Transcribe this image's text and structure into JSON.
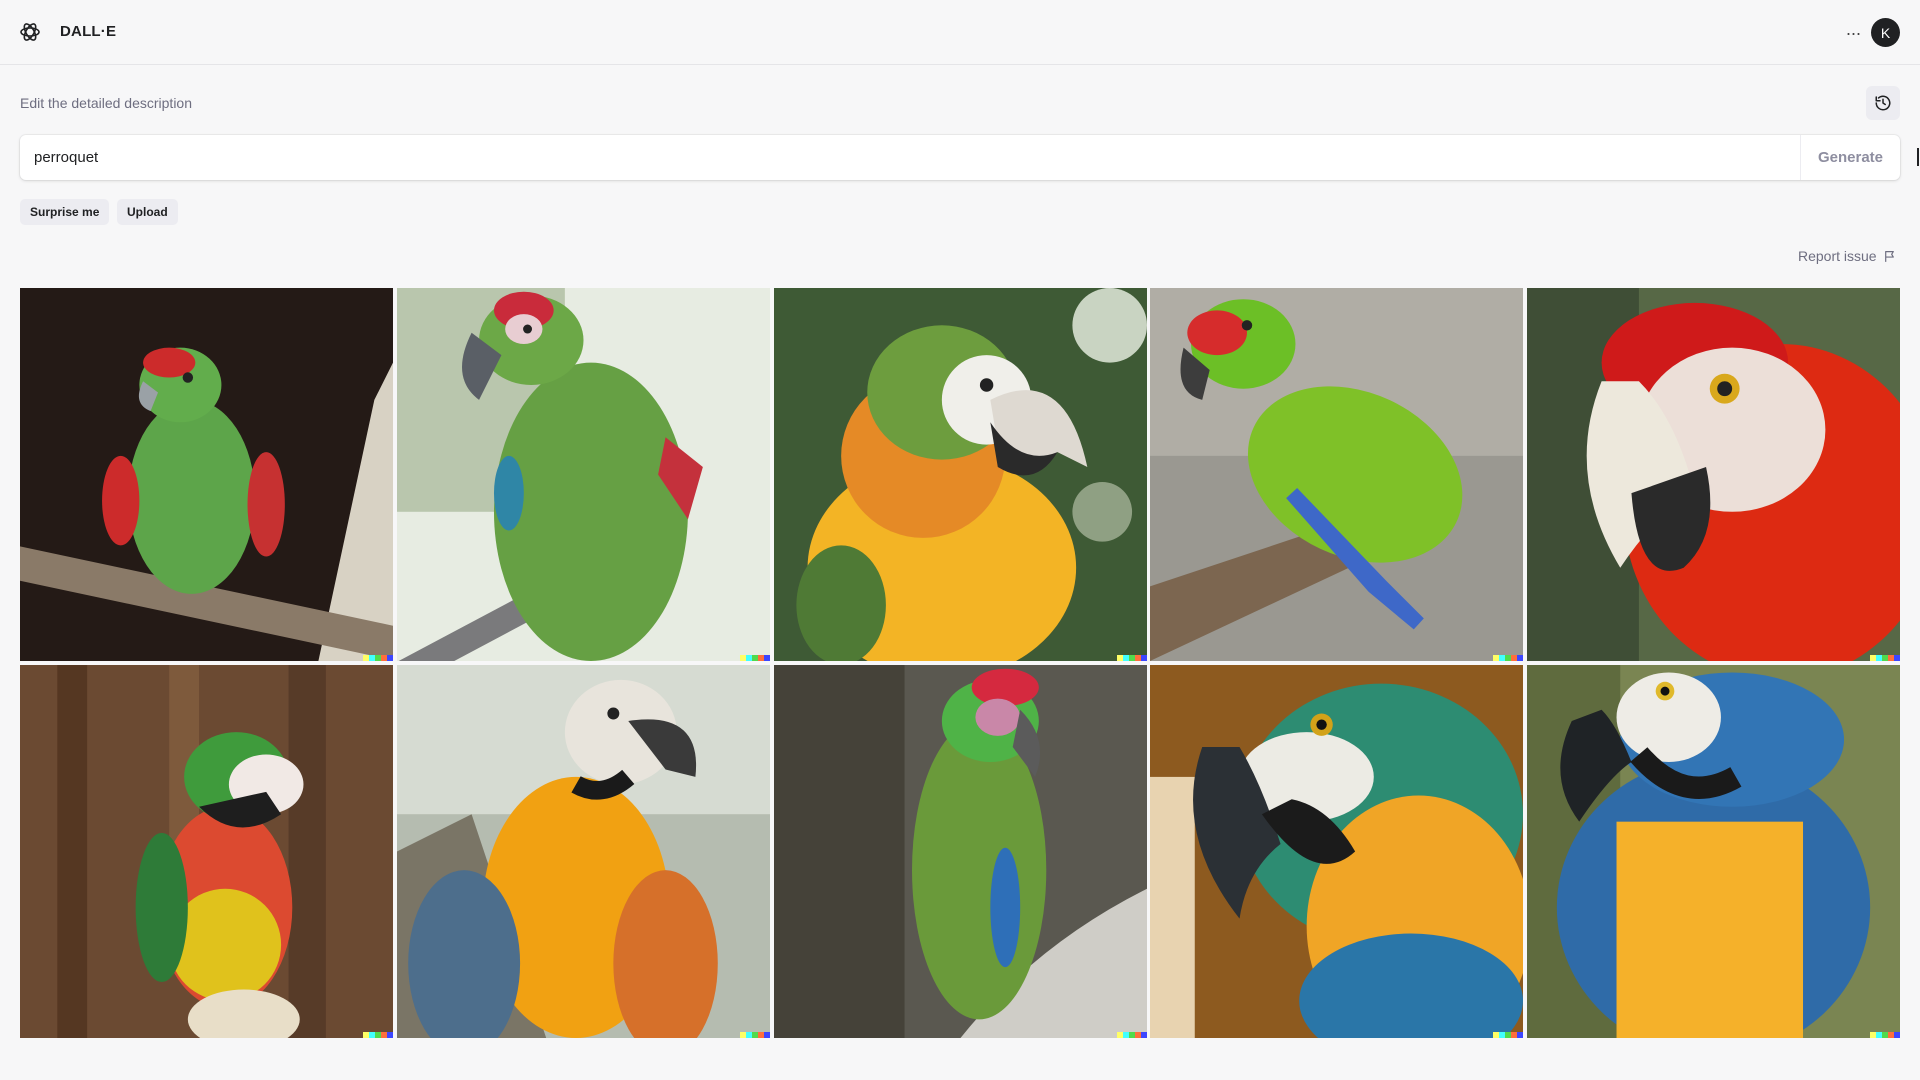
{
  "header": {
    "title": "DALL·E",
    "avatar_initial": "K",
    "more_label": "···"
  },
  "prompt": {
    "caption": "Edit the detailed description",
    "value": "perroquet",
    "generate_label": "Generate"
  },
  "actions": {
    "surprise_label": "Surprise me",
    "upload_label": "Upload",
    "report_label": "Report issue"
  },
  "images": [
    {
      "subject": "green parrot with red forehead on branch, dark background"
    },
    {
      "subject": "green military macaw, light background"
    },
    {
      "subject": "blue-and-gold macaw hybrid close-up, green background"
    },
    {
      "subject": "green parrot with red face on branch"
    },
    {
      "subject": "scarlet macaw head close-up"
    },
    {
      "subject": "multicolor macaw hybrid on perch"
    },
    {
      "subject": "orange macaw hybrid, blue wings"
    },
    {
      "subject": "green macaw with red forehead on rock"
    },
    {
      "subject": "blue-and-yellow macaw head close-up, brown background"
    },
    {
      "subject": "blue-and-yellow macaw portrait, green background"
    }
  ],
  "colors": {
    "accent": "#202123",
    "background": "#f7f7f8",
    "signature": [
      "#ffff66",
      "#42ffff",
      "#51da4c",
      "#ff6e3c",
      "#3c46ff"
    ]
  }
}
